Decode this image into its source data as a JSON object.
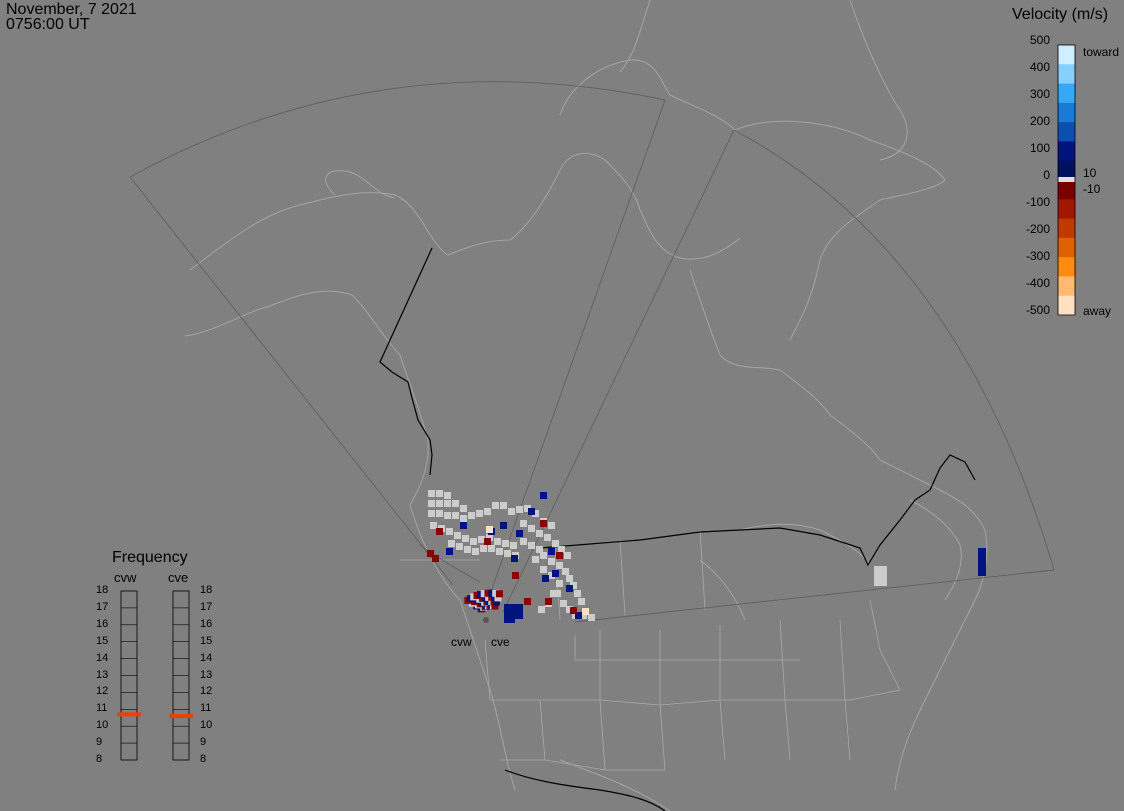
{
  "header": {
    "date": "November, 7 2021",
    "time": "0756:00 UT"
  },
  "colorbar": {
    "title": "Velocity (m/s)",
    "ticks": [
      "500",
      "400",
      "300",
      "200",
      "100",
      "0",
      "-100",
      "-200",
      "-300",
      "-400",
      "-500"
    ],
    "toward_label": "toward",
    "away_label": "away",
    "near_zero_pos": "10",
    "near_zero_neg": "-10",
    "colors": [
      "#cfeeff",
      "#86d0ff",
      "#36a9f6",
      "#1a7ad8",
      "#0b4fb0",
      "#00147d",
      "#001060",
      "#7a0000",
      "#a01800",
      "#c03a00",
      "#e06000",
      "#ff8a10",
      "#ffba70",
      "#ffe0c0"
    ]
  },
  "frequency": {
    "title": "Frequency",
    "radars": [
      {
        "name": "cvw",
        "value_mhz": 10.7
      },
      {
        "name": "cve",
        "value_mhz": 10.6
      }
    ],
    "ticks": [
      "18",
      "17",
      "16",
      "15",
      "14",
      "13",
      "12",
      "11",
      "10",
      "9",
      "8"
    ],
    "marker_color": "#e8420a"
  },
  "sites": [
    {
      "name": "cvw"
    },
    {
      "name": "cve"
    }
  ]
}
